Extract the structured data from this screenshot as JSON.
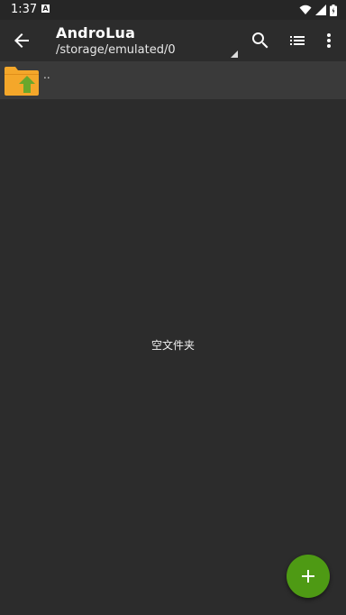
{
  "status_bar": {
    "time": "1:37",
    "notification_icon": "a-icon",
    "icons": [
      "wifi-icon",
      "signal-icon",
      "battery-icon"
    ]
  },
  "app_bar": {
    "title": "AndroLua",
    "path": "/storage/emulated/0",
    "back_icon": "arrow-left-icon",
    "actions": [
      "search-icon",
      "list-view-icon",
      "more-vert-icon"
    ]
  },
  "file_list": {
    "parent_item": {
      "label": "..",
      "icon": "folder-up-icon"
    }
  },
  "empty_state": {
    "message": "空文件夹"
  },
  "fab": {
    "icon": "plus-icon"
  },
  "colors": {
    "background": "#2c2c2c",
    "row_background": "#3a3a3a",
    "fab": "#4e9a14",
    "folder": "#f4a72a",
    "folder_arrow": "#6aa72c"
  }
}
